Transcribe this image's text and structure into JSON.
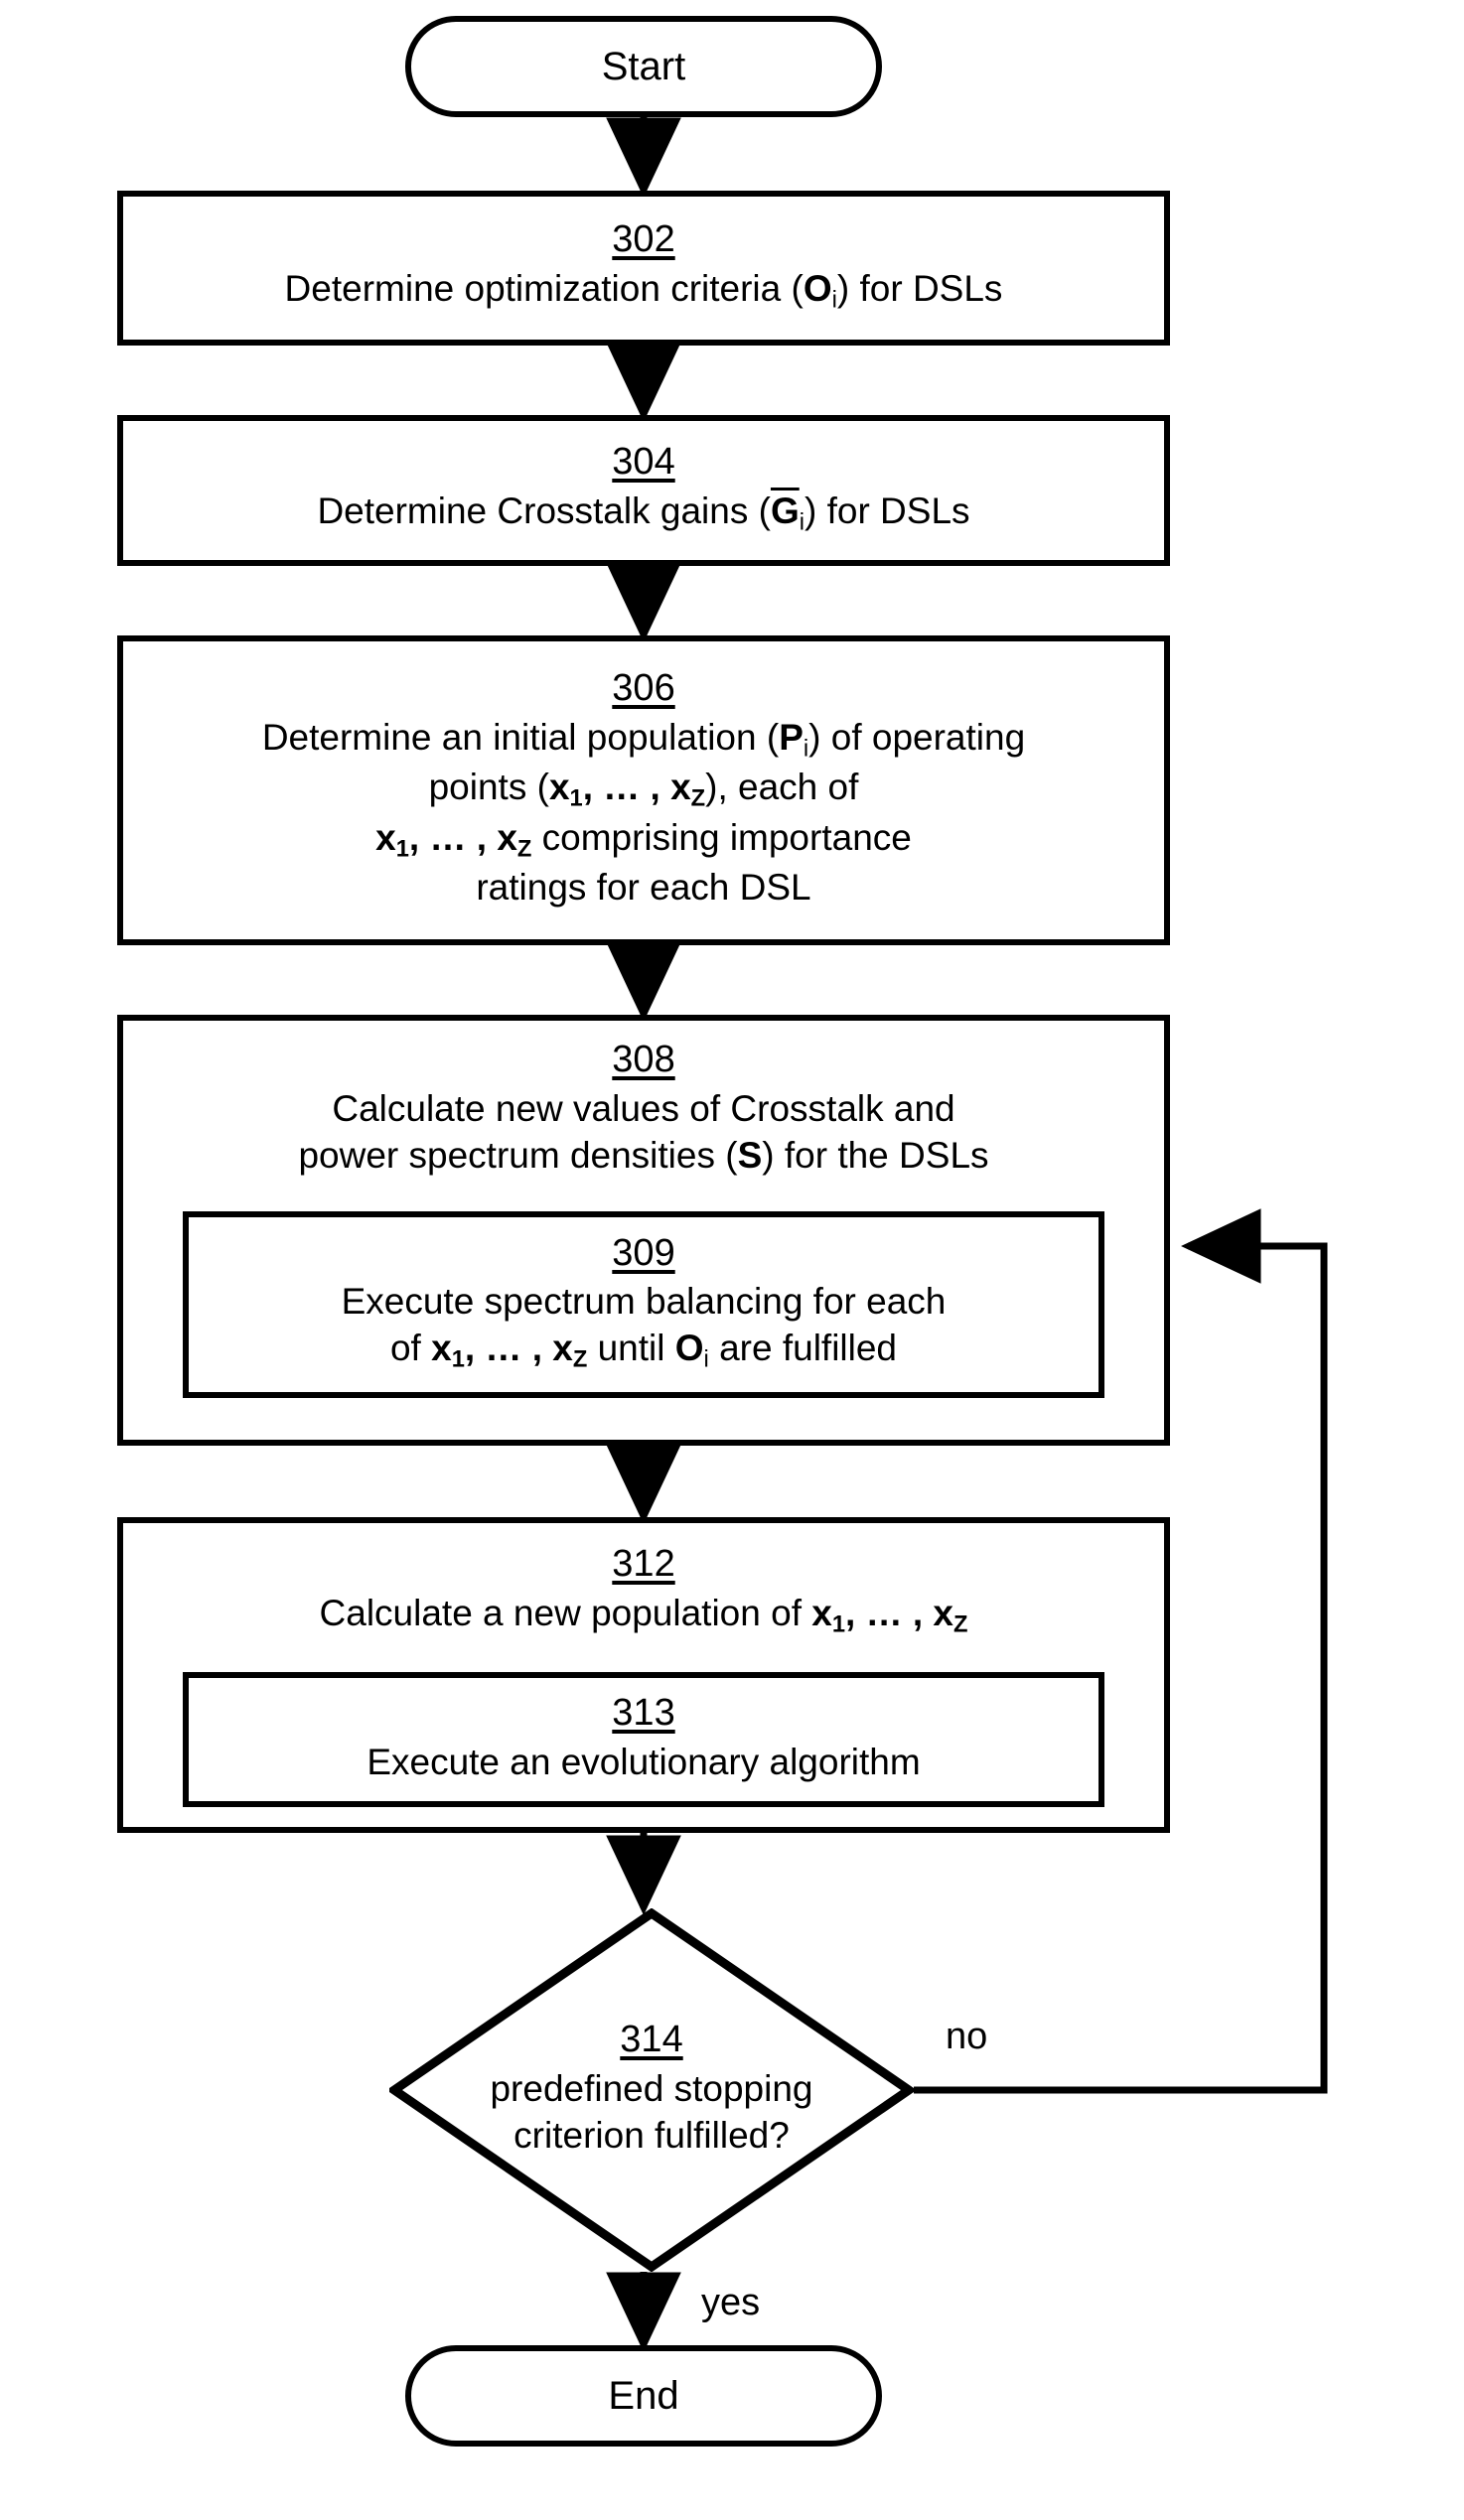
{
  "figure": {
    "type": "flowchart",
    "orientation": "vertical",
    "colors": {
      "stroke": "#000000",
      "fill": "#ffffff",
      "text": "#000000"
    }
  },
  "nodes": {
    "start": {
      "shape": "terminator",
      "label": "Start"
    },
    "step302": {
      "shape": "process",
      "ref": "302",
      "lines": [
        "Determine optimization criteria (Oi) for DSLs"
      ],
      "line1_plain": "Determine optimization criteria (",
      "line1_sym": "O",
      "line1_sub": "i",
      "line1_tail": ") for DSLs"
    },
    "step304": {
      "shape": "process",
      "ref": "304",
      "line1_plain": "Determine Crosstalk gains (",
      "line1_sym": "G",
      "line1_sub": "i",
      "line1_tail": ") for DSLs"
    },
    "step306": {
      "shape": "process",
      "ref": "306",
      "l1_a": "Determine an initial population (",
      "l1_sym": "P",
      "l1_sub": "i",
      "l1_b": ") of operating",
      "l2_a": "points (",
      "l2_x1": "x",
      "l2_s1": "1",
      "l2_mid": ", … , ",
      "l2_x2": "x",
      "l2_s2": "Z",
      "l2_b": "), each of",
      "l3_x1": "x",
      "l3_s1": "1",
      "l3_mid": ", … , ",
      "l3_x2": "x",
      "l3_s2": "Z",
      "l3_b": " comprising importance",
      "l4": "ratings for each DSL"
    },
    "step308": {
      "shape": "process",
      "ref": "308",
      "l1": "Calculate new values of Crosstalk and",
      "l2_a": "power spectrum densities (",
      "l2_sym": "S",
      "l2_b": ") for the DSLs"
    },
    "step309": {
      "shape": "process",
      "ref": "309",
      "l1": "Execute spectrum balancing for each",
      "l2_a": "of ",
      "l2_x1": "x",
      "l2_s1": "1",
      "l2_mid": ", … , ",
      "l2_x2": "x",
      "l2_s2": "Z",
      "l2_b": " until ",
      "l2_sym": "O",
      "l2_sub": "i",
      "l2_c": " are fulfilled"
    },
    "step312": {
      "shape": "process",
      "ref": "312",
      "l1_a": "Calculate a new population of ",
      "l1_x1": "x",
      "l1_s1": "1",
      "l1_mid": ", … , ",
      "l1_x2": "x",
      "l1_s2": "Z"
    },
    "step313": {
      "shape": "process",
      "ref": "313",
      "l1": "Execute an evolutionary algorithm"
    },
    "decision314": {
      "shape": "diamond",
      "ref": "314",
      "l1": "predefined stopping",
      "l2": "criterion fulfilled?"
    },
    "end": {
      "shape": "terminator",
      "label": "End"
    }
  },
  "edges": {
    "no_label": "no",
    "yes_label": "yes"
  }
}
